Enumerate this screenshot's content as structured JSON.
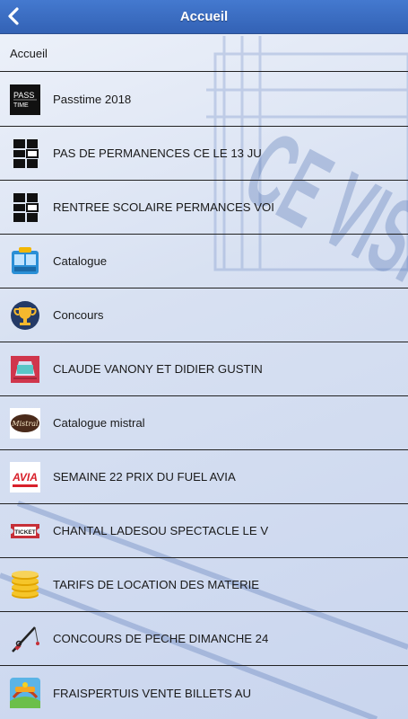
{
  "header": {
    "title": "Accueil",
    "back_icon": "chevron-left-icon"
  },
  "breadcrumb": "Accueil",
  "watermark_text": "CE VISKASE",
  "items": [
    {
      "label": "Passtime 2018",
      "icon": "passtime-logo-icon",
      "logo_lines": [
        "PASS",
        "TIME"
      ]
    },
    {
      "label": "PAS DE PERMANENCES CE LE 13 JU",
      "icon": "black-tiles-icon"
    },
    {
      "label": "RENTREE SCOLAIRE PERMANCES VOI",
      "icon": "black-tiles-icon"
    },
    {
      "label": "Catalogue",
      "icon": "catalogue-icon"
    },
    {
      "label": "Concours",
      "icon": "trophy-icon"
    },
    {
      "label": "CLAUDE VANONY ET DIDIER GUSTIN",
      "icon": "theatre-stage-icon"
    },
    {
      "label": "Catalogue mistral",
      "icon": "mistral-logo-icon",
      "logo_text": "Mistral"
    },
    {
      "label": "SEMAINE 22 PRIX DU FUEL AVIA",
      "icon": "avia-logo-icon",
      "logo_text": "AVIA"
    },
    {
      "label": "CHANTAL LADESOU SPECTACLE LE V",
      "icon": "ticket-icon",
      "logo_text": "TICKET"
    },
    {
      "label": "TARIFS DE LOCATION DES MATERIE",
      "icon": "coins-stack-icon"
    },
    {
      "label": "CONCOURS DE PECHE DIMANCHE 24",
      "icon": "fishing-rod-icon"
    },
    {
      "label": "FRAISPERTUIS VENTE BILLETS AU",
      "icon": "amusement-park-icon"
    }
  ],
  "colors": {
    "header_bg": "#3b6fc4",
    "divider": "#222222",
    "text": "#1a1a1a"
  }
}
